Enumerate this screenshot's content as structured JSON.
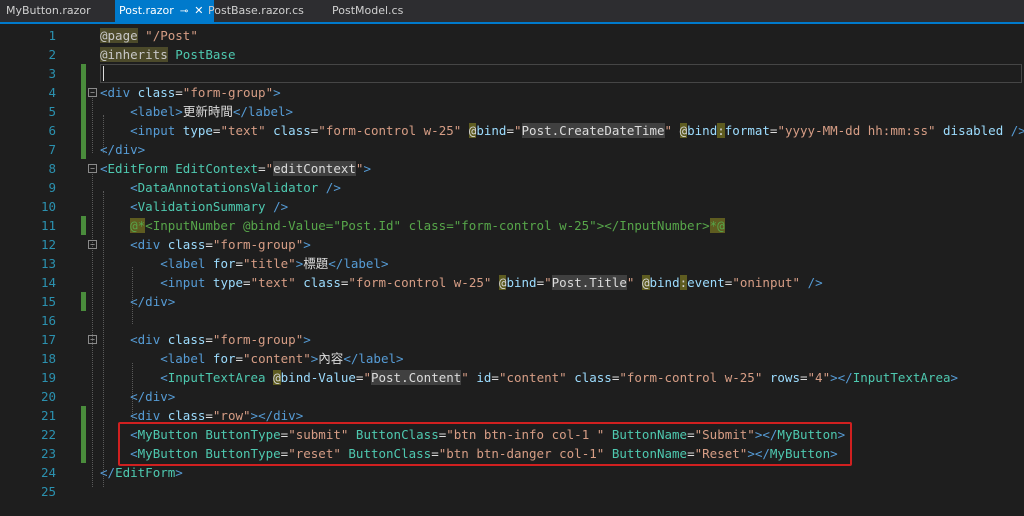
{
  "tabs": [
    {
      "label": "MyButton.razor",
      "active": false
    },
    {
      "label": "Post.razor",
      "active": true,
      "pin": "⊸",
      "close": "✕"
    },
    {
      "label": "PostBase.razor.cs",
      "active": false
    },
    {
      "label": "PostModel.cs",
      "active": false
    }
  ],
  "colors": {
    "background": "#1e1e1e",
    "line_number": "#2b91af",
    "change_bar": "#4a8c3c",
    "tag": "#569cd6",
    "component": "#4ec9b0",
    "attribute": "#9cdcfe",
    "string": "#d69d85",
    "comment": "#57a64a",
    "highlight_box": "#d02020"
  },
  "icons": {
    "fold": "collapse-minus-icon",
    "close": "close-icon",
    "pin": "pin-icon"
  },
  "code_lines": [
    {
      "n": "1",
      "tokens": [
        [
          "@page",
          "kw"
        ],
        [
          " ",
          "def"
        ],
        [
          "\"/Post\"",
          "str"
        ]
      ]
    },
    {
      "n": "2",
      "tokens": [
        [
          "@inherits",
          "kw"
        ],
        [
          " ",
          "def"
        ],
        [
          "PostBase",
          "comp"
        ]
      ]
    },
    {
      "n": "3",
      "tokens": []
    },
    {
      "n": "4",
      "tokens": [
        [
          "<",
          "tag"
        ],
        [
          "div",
          "tag"
        ],
        [
          " class",
          "attr"
        ],
        [
          "=",
          "eq"
        ],
        [
          "\"form-group\"",
          "str"
        ],
        [
          ">",
          "tag"
        ]
      ]
    },
    {
      "n": "5",
      "tokens": [
        [
          "    ",
          "def"
        ],
        [
          "<",
          "tag"
        ],
        [
          "label",
          "tag"
        ],
        [
          ">",
          "tag"
        ],
        [
          "更新時間",
          "def"
        ],
        [
          "</",
          "tag"
        ],
        [
          "label",
          "tag"
        ],
        [
          ">",
          "tag"
        ]
      ]
    },
    {
      "n": "6",
      "tokens": [
        [
          "    ",
          "def"
        ],
        [
          "<",
          "tag"
        ],
        [
          "input",
          "tag"
        ],
        [
          " type",
          "attr"
        ],
        [
          "=",
          "eq"
        ],
        [
          "\"text\"",
          "str"
        ],
        [
          " class",
          "attr"
        ],
        [
          "=",
          "eq"
        ],
        [
          "\"form-control w-25\"",
          "str"
        ],
        [
          " ",
          "def"
        ],
        [
          "@",
          "rz"
        ],
        [
          "bind",
          "attr"
        ],
        [
          "=",
          "eq"
        ],
        [
          "\"",
          "str"
        ],
        [
          "Post.CreateDateTime",
          "hl"
        ],
        [
          "\"",
          "str"
        ],
        [
          " ",
          "def"
        ],
        [
          "@",
          "rz"
        ],
        [
          "bind",
          "attr"
        ],
        [
          ":",
          "rz"
        ],
        [
          "format",
          "attr"
        ],
        [
          "=",
          "eq"
        ],
        [
          "\"yyyy-MM-dd hh:mm:ss\"",
          "str"
        ],
        [
          " disabled",
          "attr"
        ],
        [
          " />",
          "tag"
        ]
      ]
    },
    {
      "n": "7",
      "tokens": [
        [
          "</",
          "tag"
        ],
        [
          "div",
          "tag"
        ],
        [
          ">",
          "tag"
        ]
      ]
    },
    {
      "n": "8",
      "tokens": [
        [
          "<",
          "tag"
        ],
        [
          "EditForm",
          "comp"
        ],
        [
          " EditContext",
          "comp"
        ],
        [
          "=",
          "eq"
        ],
        [
          "\"",
          "str"
        ],
        [
          "editContext",
          "hl"
        ],
        [
          "\"",
          "str"
        ],
        [
          ">",
          "tag"
        ]
      ]
    },
    {
      "n": "9",
      "tokens": [
        [
          "    ",
          "def"
        ],
        [
          "<",
          "tag"
        ],
        [
          "DataAnnotationsValidator",
          "comp"
        ],
        [
          " />",
          "tag"
        ]
      ]
    },
    {
      "n": "10",
      "tokens": [
        [
          "    ",
          "def"
        ],
        [
          "<",
          "tag"
        ],
        [
          "ValidationSummary",
          "comp"
        ],
        [
          " />",
          "tag"
        ]
      ]
    },
    {
      "n": "11",
      "tokens": [
        [
          "    ",
          "def"
        ],
        [
          "@*",
          "cmtb"
        ],
        [
          "<InputNumber @bind-Value=\"Post.Id\" class=\"form-control w-25\"></InputNumber>",
          "cmt"
        ],
        [
          "*@",
          "cmtb"
        ]
      ]
    },
    {
      "n": "12",
      "tokens": [
        [
          "    ",
          "def"
        ],
        [
          "<",
          "tag"
        ],
        [
          "div",
          "tag"
        ],
        [
          " class",
          "attr"
        ],
        [
          "=",
          "eq"
        ],
        [
          "\"form-group\"",
          "str"
        ],
        [
          ">",
          "tag"
        ]
      ]
    },
    {
      "n": "13",
      "tokens": [
        [
          "        ",
          "def"
        ],
        [
          "<",
          "tag"
        ],
        [
          "label",
          "tag"
        ],
        [
          " for",
          "attr"
        ],
        [
          "=",
          "eq"
        ],
        [
          "\"title\"",
          "str"
        ],
        [
          ">",
          "tag"
        ],
        [
          "標題",
          "def"
        ],
        [
          "</",
          "tag"
        ],
        [
          "label",
          "tag"
        ],
        [
          ">",
          "tag"
        ]
      ]
    },
    {
      "n": "14",
      "tokens": [
        [
          "        ",
          "def"
        ],
        [
          "<",
          "tag"
        ],
        [
          "input",
          "tag"
        ],
        [
          " type",
          "attr"
        ],
        [
          "=",
          "eq"
        ],
        [
          "\"text\"",
          "str"
        ],
        [
          " class",
          "attr"
        ],
        [
          "=",
          "eq"
        ],
        [
          "\"form-control w-25\"",
          "str"
        ],
        [
          " ",
          "def"
        ],
        [
          "@",
          "rz"
        ],
        [
          "bind",
          "attr"
        ],
        [
          "=",
          "eq"
        ],
        [
          "\"",
          "str"
        ],
        [
          "Post.Title",
          "hl"
        ],
        [
          "\"",
          "str"
        ],
        [
          " ",
          "def"
        ],
        [
          "@",
          "rz"
        ],
        [
          "bind",
          "attr"
        ],
        [
          ":",
          "rz"
        ],
        [
          "event",
          "attr"
        ],
        [
          "=",
          "eq"
        ],
        [
          "\"oninput\"",
          "str"
        ],
        [
          " />",
          "tag"
        ]
      ]
    },
    {
      "n": "15",
      "tokens": [
        [
          "    ",
          "def"
        ],
        [
          "</",
          "tag"
        ],
        [
          "div",
          "tag"
        ],
        [
          ">",
          "tag"
        ]
      ]
    },
    {
      "n": "16",
      "tokens": []
    },
    {
      "n": "17",
      "tokens": [
        [
          "    ",
          "def"
        ],
        [
          "<",
          "tag"
        ],
        [
          "div",
          "tag"
        ],
        [
          " class",
          "attr"
        ],
        [
          "=",
          "eq"
        ],
        [
          "\"form-group\"",
          "str"
        ],
        [
          ">",
          "tag"
        ]
      ]
    },
    {
      "n": "18",
      "tokens": [
        [
          "        ",
          "def"
        ],
        [
          "<",
          "tag"
        ],
        [
          "label",
          "tag"
        ],
        [
          " for",
          "attr"
        ],
        [
          "=",
          "eq"
        ],
        [
          "\"content\"",
          "str"
        ],
        [
          ">",
          "tag"
        ],
        [
          "內容",
          "def"
        ],
        [
          "</",
          "tag"
        ],
        [
          "label",
          "tag"
        ],
        [
          ">",
          "tag"
        ]
      ]
    },
    {
      "n": "19",
      "tokens": [
        [
          "        ",
          "def"
        ],
        [
          "<",
          "tag"
        ],
        [
          "InputTextArea",
          "comp"
        ],
        [
          " ",
          "def"
        ],
        [
          "@",
          "rz"
        ],
        [
          "bind-Value",
          "attr"
        ],
        [
          "=",
          "eq"
        ],
        [
          "\"",
          "str"
        ],
        [
          "Post.Content",
          "hl"
        ],
        [
          "\"",
          "str"
        ],
        [
          " id",
          "attr"
        ],
        [
          "=",
          "eq"
        ],
        [
          "\"content\"",
          "str"
        ],
        [
          " class",
          "attr"
        ],
        [
          "=",
          "eq"
        ],
        [
          "\"form-control w-25\"",
          "str"
        ],
        [
          " rows",
          "attr"
        ],
        [
          "=",
          "eq"
        ],
        [
          "\"4\"",
          "str"
        ],
        [
          "></",
          "tag"
        ],
        [
          "InputTextArea",
          "comp"
        ],
        [
          ">",
          "tag"
        ]
      ]
    },
    {
      "n": "20",
      "tokens": [
        [
          "    ",
          "def"
        ],
        [
          "</",
          "tag"
        ],
        [
          "div",
          "tag"
        ],
        [
          ">",
          "tag"
        ]
      ]
    },
    {
      "n": "21",
      "tokens": [
        [
          "    ",
          "def"
        ],
        [
          "<",
          "tag"
        ],
        [
          "div",
          "tag"
        ],
        [
          " class",
          "attr"
        ],
        [
          "=",
          "eq"
        ],
        [
          "\"row\"",
          "str"
        ],
        [
          "></",
          "tag"
        ],
        [
          "div",
          "tag"
        ],
        [
          ">",
          "tag"
        ]
      ]
    },
    {
      "n": "22",
      "tokens": [
        [
          "    ",
          "def"
        ],
        [
          "<",
          "tag"
        ],
        [
          "MyButton",
          "comp"
        ],
        [
          " ButtonType",
          "comp"
        ],
        [
          "=",
          "eq"
        ],
        [
          "\"submit\"",
          "str"
        ],
        [
          " ButtonClass",
          "comp"
        ],
        [
          "=",
          "eq"
        ],
        [
          "\"btn btn-info col-1 \"",
          "str"
        ],
        [
          " ButtonName",
          "comp"
        ],
        [
          "=",
          "eq"
        ],
        [
          "\"Submit\"",
          "str"
        ],
        [
          "></",
          "tag"
        ],
        [
          "MyButton",
          "comp"
        ],
        [
          ">",
          "tag"
        ]
      ]
    },
    {
      "n": "23",
      "tokens": [
        [
          "    ",
          "def"
        ],
        [
          "<",
          "tag"
        ],
        [
          "MyButton",
          "comp"
        ],
        [
          " ButtonType",
          "comp"
        ],
        [
          "=",
          "eq"
        ],
        [
          "\"reset\"",
          "str"
        ],
        [
          " ButtonClass",
          "comp"
        ],
        [
          "=",
          "eq"
        ],
        [
          "\"btn btn-danger col-1\"",
          "str"
        ],
        [
          " ButtonName",
          "comp"
        ],
        [
          "=",
          "eq"
        ],
        [
          "\"Reset\"",
          "str"
        ],
        [
          "></",
          "tag"
        ],
        [
          "MyButton",
          "comp"
        ],
        [
          ">",
          "tag"
        ]
      ]
    },
    {
      "n": "24",
      "tokens": [
        [
          "</",
          "tag"
        ],
        [
          "EditForm",
          "comp"
        ],
        [
          ">",
          "tag"
        ]
      ]
    },
    {
      "n": "25",
      "tokens": []
    }
  ]
}
